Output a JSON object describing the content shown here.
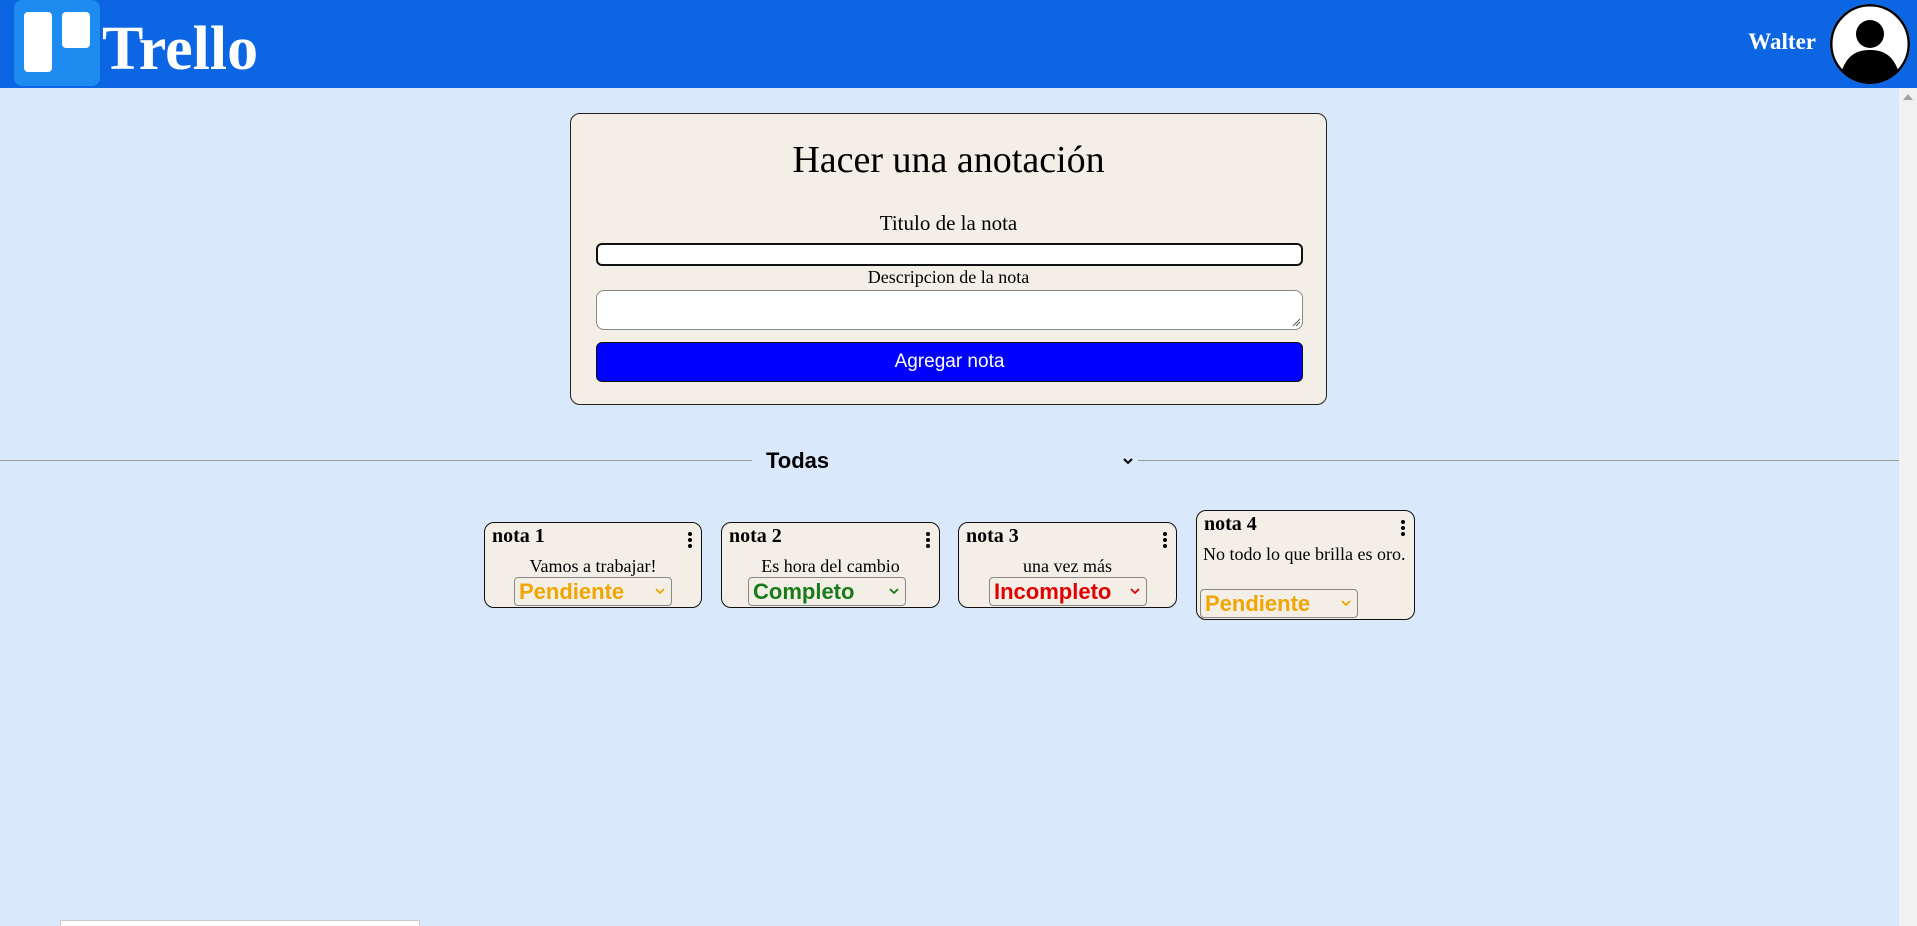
{
  "header": {
    "logo_text": "Trello",
    "user_name": "Walter"
  },
  "colors": {
    "header_bg": "#0c66e4",
    "page_bg": "#dae8fc",
    "card_bg": "#f3efe7",
    "button_bg": "#0000ff",
    "pending": "#f0a500",
    "complete": "#1a7a1a",
    "incomplete": "#e00000"
  },
  "form": {
    "heading": "Hacer una anotación",
    "title_label": "Titulo de la nota",
    "title_value": "",
    "description_label": "Descripcion de la nota",
    "description_value": "",
    "submit_label": "Agregar nota"
  },
  "filter": {
    "selected": "Todas"
  },
  "notes": [
    {
      "title": "nota 1",
      "description": "Vamos a trabajar!",
      "status": "Pendiente"
    },
    {
      "title": "nota 2",
      "description": "Es hora del cambio",
      "status": "Completo"
    },
    {
      "title": "nota 3",
      "description": "una vez más",
      "status": "Incompleto"
    },
    {
      "title": "nota 4",
      "description": "No todo lo que brilla es oro.",
      "status": "Pendiente"
    }
  ],
  "icons": {
    "logo": "trello-logo-icon",
    "avatar": "user-avatar-icon",
    "menu": "vertical-dots-icon",
    "chevron": "chevron-down-icon"
  }
}
